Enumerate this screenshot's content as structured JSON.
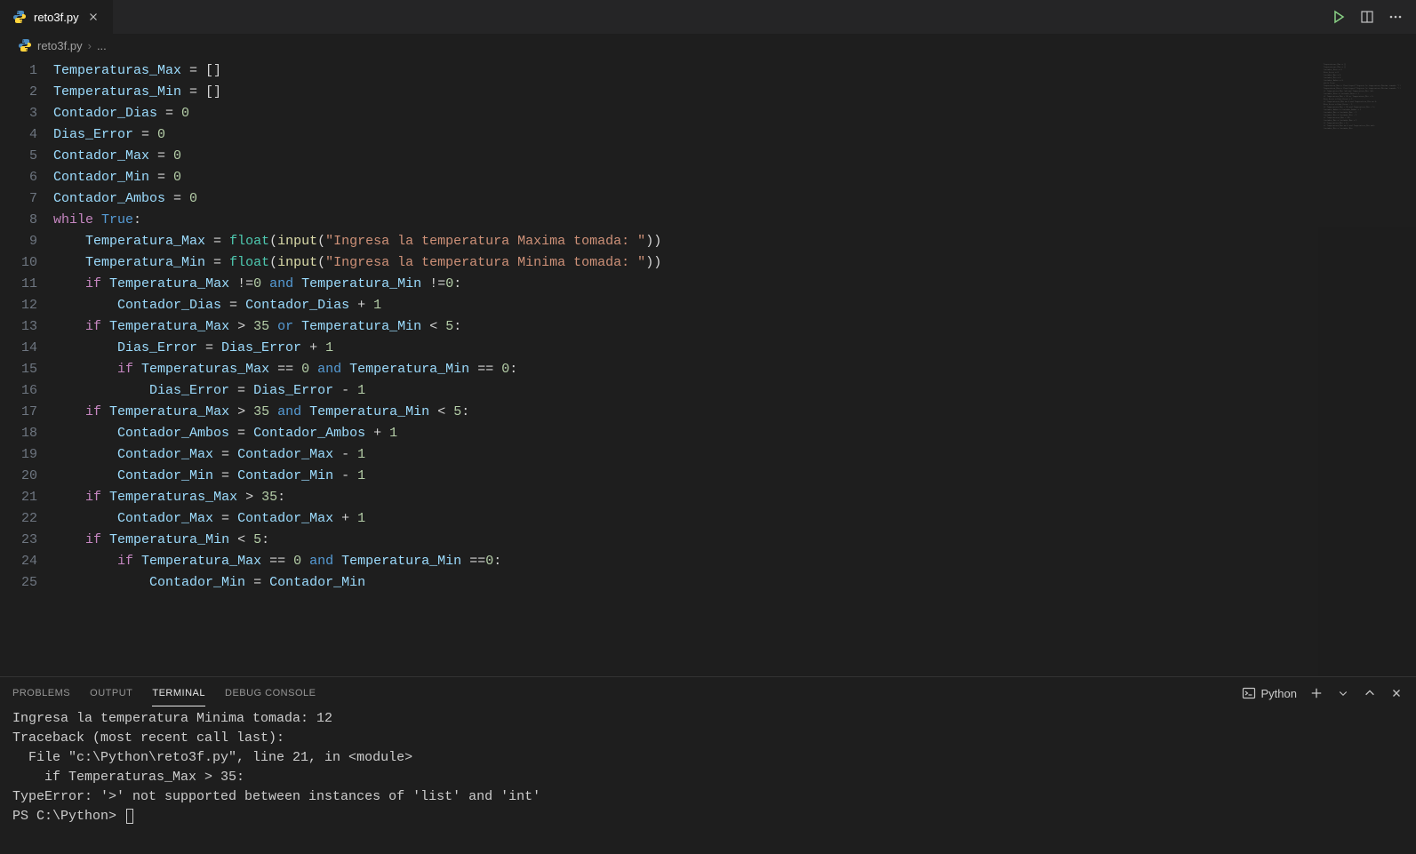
{
  "tab": {
    "filename": "reto3f.py"
  },
  "editor_actions": {
    "run": "run-icon",
    "split": "split-icon",
    "more": "more-icon"
  },
  "breadcrumb": {
    "filename": "reto3f.py",
    "more": "..."
  },
  "code_lines": [
    {
      "n": 1,
      "tokens": [
        {
          "t": "Temperaturas_Max",
          "c": "var"
        },
        {
          "t": " = ",
          "c": "op"
        },
        {
          "t": "[]",
          "c": "punct"
        }
      ]
    },
    {
      "n": 2,
      "tokens": [
        {
          "t": "Temperaturas_Min",
          "c": "var"
        },
        {
          "t": " = ",
          "c": "op"
        },
        {
          "t": "[]",
          "c": "punct"
        }
      ]
    },
    {
      "n": 3,
      "tokens": [
        {
          "t": "Contador_Dias",
          "c": "var"
        },
        {
          "t": " = ",
          "c": "op"
        },
        {
          "t": "0",
          "c": "num"
        }
      ]
    },
    {
      "n": 4,
      "tokens": [
        {
          "t": "Dias_Error",
          "c": "var"
        },
        {
          "t": " = ",
          "c": "op"
        },
        {
          "t": "0",
          "c": "num"
        }
      ]
    },
    {
      "n": 5,
      "tokens": [
        {
          "t": "Contador_Max",
          "c": "var"
        },
        {
          "t": " = ",
          "c": "op"
        },
        {
          "t": "0",
          "c": "num"
        }
      ]
    },
    {
      "n": 6,
      "tokens": [
        {
          "t": "Contador_Min",
          "c": "var"
        },
        {
          "t": " = ",
          "c": "op"
        },
        {
          "t": "0",
          "c": "num"
        }
      ]
    },
    {
      "n": 7,
      "tokens": [
        {
          "t": "Contador_Ambos",
          "c": "var"
        },
        {
          "t": " = ",
          "c": "op"
        },
        {
          "t": "0",
          "c": "num"
        }
      ]
    },
    {
      "n": 8,
      "tokens": [
        {
          "t": "while",
          "c": "kw"
        },
        {
          "t": " ",
          "c": "text"
        },
        {
          "t": "True",
          "c": "const"
        },
        {
          "t": ":",
          "c": "punct"
        }
      ]
    },
    {
      "n": 9,
      "indent": 1,
      "tokens": [
        {
          "t": "Temperatura_Max",
          "c": "var"
        },
        {
          "t": " = ",
          "c": "op"
        },
        {
          "t": "float",
          "c": "type"
        },
        {
          "t": "(",
          "c": "punct"
        },
        {
          "t": "input",
          "c": "func"
        },
        {
          "t": "(",
          "c": "punct"
        },
        {
          "t": "\"Ingresa la temperatura Maxima tomada: \"",
          "c": "str"
        },
        {
          "t": "))",
          "c": "punct"
        }
      ]
    },
    {
      "n": 10,
      "indent": 1,
      "tokens": [
        {
          "t": "Temperatura_Min",
          "c": "var"
        },
        {
          "t": " = ",
          "c": "op"
        },
        {
          "t": "float",
          "c": "type"
        },
        {
          "t": "(",
          "c": "punct"
        },
        {
          "t": "input",
          "c": "func"
        },
        {
          "t": "(",
          "c": "punct"
        },
        {
          "t": "\"Ingresa la temperatura Minima tomada: \"",
          "c": "str"
        },
        {
          "t": "))",
          "c": "punct"
        }
      ]
    },
    {
      "n": 11,
      "indent": 1,
      "tokens": [
        {
          "t": "if",
          "c": "kw"
        },
        {
          "t": " ",
          "c": "text"
        },
        {
          "t": "Temperatura_Max",
          "c": "var"
        },
        {
          "t": " !=",
          "c": "op"
        },
        {
          "t": "0",
          "c": "num"
        },
        {
          "t": " ",
          "c": "text"
        },
        {
          "t": "and",
          "c": "const"
        },
        {
          "t": " ",
          "c": "text"
        },
        {
          "t": "Temperatura_Min",
          "c": "var"
        },
        {
          "t": " !=",
          "c": "op"
        },
        {
          "t": "0",
          "c": "num"
        },
        {
          "t": ":",
          "c": "punct"
        }
      ]
    },
    {
      "n": 12,
      "indent": 2,
      "tokens": [
        {
          "t": "Contador_Dias",
          "c": "var"
        },
        {
          "t": " = ",
          "c": "op"
        },
        {
          "t": "Contador_Dias",
          "c": "var"
        },
        {
          "t": " + ",
          "c": "op"
        },
        {
          "t": "1",
          "c": "num"
        }
      ]
    },
    {
      "n": 13,
      "indent": 1,
      "tokens": [
        {
          "t": "if",
          "c": "kw"
        },
        {
          "t": " ",
          "c": "text"
        },
        {
          "t": "Temperatura_Max",
          "c": "var"
        },
        {
          "t": " > ",
          "c": "op"
        },
        {
          "t": "35",
          "c": "num"
        },
        {
          "t": " ",
          "c": "text"
        },
        {
          "t": "or",
          "c": "const"
        },
        {
          "t": " ",
          "c": "text"
        },
        {
          "t": "Temperatura_Min",
          "c": "var"
        },
        {
          "t": " < ",
          "c": "op"
        },
        {
          "t": "5",
          "c": "num"
        },
        {
          "t": ":",
          "c": "punct"
        }
      ]
    },
    {
      "n": 14,
      "indent": 2,
      "tokens": [
        {
          "t": "Dias_Error",
          "c": "var"
        },
        {
          "t": " = ",
          "c": "op"
        },
        {
          "t": "Dias_Error",
          "c": "var"
        },
        {
          "t": " + ",
          "c": "op"
        },
        {
          "t": "1",
          "c": "num"
        }
      ]
    },
    {
      "n": 15,
      "indent": 2,
      "tokens": [
        {
          "t": "if",
          "c": "kw"
        },
        {
          "t": " ",
          "c": "text"
        },
        {
          "t": "Temperaturas_Max",
          "c": "var"
        },
        {
          "t": " == ",
          "c": "op"
        },
        {
          "t": "0",
          "c": "num"
        },
        {
          "t": " ",
          "c": "text"
        },
        {
          "t": "and",
          "c": "const"
        },
        {
          "t": " ",
          "c": "text"
        },
        {
          "t": "Temperatura_Min",
          "c": "var"
        },
        {
          "t": " == ",
          "c": "op"
        },
        {
          "t": "0",
          "c": "num"
        },
        {
          "t": ":",
          "c": "punct"
        }
      ]
    },
    {
      "n": 16,
      "indent": 3,
      "tokens": [
        {
          "t": "Dias_Error",
          "c": "var"
        },
        {
          "t": " = ",
          "c": "op"
        },
        {
          "t": "Dias_Error",
          "c": "var"
        },
        {
          "t": " - ",
          "c": "op"
        },
        {
          "t": "1",
          "c": "num"
        }
      ]
    },
    {
      "n": 17,
      "indent": 1,
      "tokens": [
        {
          "t": "if",
          "c": "kw"
        },
        {
          "t": " ",
          "c": "text"
        },
        {
          "t": "Temperatura_Max",
          "c": "var"
        },
        {
          "t": " > ",
          "c": "op"
        },
        {
          "t": "35",
          "c": "num"
        },
        {
          "t": " ",
          "c": "text"
        },
        {
          "t": "and",
          "c": "const"
        },
        {
          "t": " ",
          "c": "text"
        },
        {
          "t": "Temperatura_Min",
          "c": "var"
        },
        {
          "t": " < ",
          "c": "op"
        },
        {
          "t": "5",
          "c": "num"
        },
        {
          "t": ":",
          "c": "punct"
        }
      ]
    },
    {
      "n": 18,
      "indent": 2,
      "tokens": [
        {
          "t": "Contador_Ambos",
          "c": "var"
        },
        {
          "t": " = ",
          "c": "op"
        },
        {
          "t": "Contador_Ambos",
          "c": "var"
        },
        {
          "t": " + ",
          "c": "op"
        },
        {
          "t": "1",
          "c": "num"
        }
      ]
    },
    {
      "n": 19,
      "indent": 2,
      "tokens": [
        {
          "t": "Contador_Max",
          "c": "var"
        },
        {
          "t": " = ",
          "c": "op"
        },
        {
          "t": "Contador_Max",
          "c": "var"
        },
        {
          "t": " - ",
          "c": "op"
        },
        {
          "t": "1",
          "c": "num"
        }
      ]
    },
    {
      "n": 20,
      "indent": 2,
      "tokens": [
        {
          "t": "Contador_Min",
          "c": "var"
        },
        {
          "t": " = ",
          "c": "op"
        },
        {
          "t": "Contador_Min",
          "c": "var"
        },
        {
          "t": " - ",
          "c": "op"
        },
        {
          "t": "1",
          "c": "num"
        }
      ]
    },
    {
      "n": 21,
      "indent": 1,
      "tokens": [
        {
          "t": "if",
          "c": "kw"
        },
        {
          "t": " ",
          "c": "text"
        },
        {
          "t": "Temperaturas_Max",
          "c": "var"
        },
        {
          "t": " > ",
          "c": "op"
        },
        {
          "t": "35",
          "c": "num"
        },
        {
          "t": ":",
          "c": "punct"
        }
      ]
    },
    {
      "n": 22,
      "indent": 2,
      "tokens": [
        {
          "t": "Contador_Max",
          "c": "var"
        },
        {
          "t": " = ",
          "c": "op"
        },
        {
          "t": "Contador_Max",
          "c": "var"
        },
        {
          "t": " + ",
          "c": "op"
        },
        {
          "t": "1",
          "c": "num"
        }
      ]
    },
    {
      "n": 23,
      "indent": 1,
      "tokens": [
        {
          "t": "if",
          "c": "kw"
        },
        {
          "t": " ",
          "c": "text"
        },
        {
          "t": "Temperatura_Min",
          "c": "var"
        },
        {
          "t": " < ",
          "c": "op"
        },
        {
          "t": "5",
          "c": "num"
        },
        {
          "t": ":",
          "c": "punct"
        }
      ]
    },
    {
      "n": 24,
      "indent": 2,
      "tokens": [
        {
          "t": "if",
          "c": "kw"
        },
        {
          "t": " ",
          "c": "text"
        },
        {
          "t": "Temperatura_Max",
          "c": "var"
        },
        {
          "t": " == ",
          "c": "op"
        },
        {
          "t": "0",
          "c": "num"
        },
        {
          "t": " ",
          "c": "text"
        },
        {
          "t": "and",
          "c": "const"
        },
        {
          "t": " ",
          "c": "text"
        },
        {
          "t": "Temperatura_Min",
          "c": "var"
        },
        {
          "t": " ==",
          "c": "op"
        },
        {
          "t": "0",
          "c": "num"
        },
        {
          "t": ":",
          "c": "punct"
        }
      ]
    },
    {
      "n": 25,
      "indent": 3,
      "tokens": [
        {
          "t": "Contador_Min",
          "c": "var"
        },
        {
          "t": " = ",
          "c": "op"
        },
        {
          "t": "Contador_Min",
          "c": "var"
        }
      ]
    }
  ],
  "panel": {
    "tabs": {
      "problems": "PROBLEMS",
      "output": "OUTPUT",
      "terminal": "TERMINAL",
      "debug": "DEBUG CONSOLE"
    },
    "active_tab": "terminal",
    "shell_label": "Python"
  },
  "terminal_lines": [
    "Ingresa la temperatura Minima tomada: 12",
    "Traceback (most recent call last):",
    "  File \"c:\\Python\\reto3f.py\", line 21, in <module>",
    "    if Temperaturas_Max > 35:",
    "TypeError: '>' not supported between instances of 'list' and 'int'"
  ],
  "terminal_prompt": "PS C:\\Python> "
}
